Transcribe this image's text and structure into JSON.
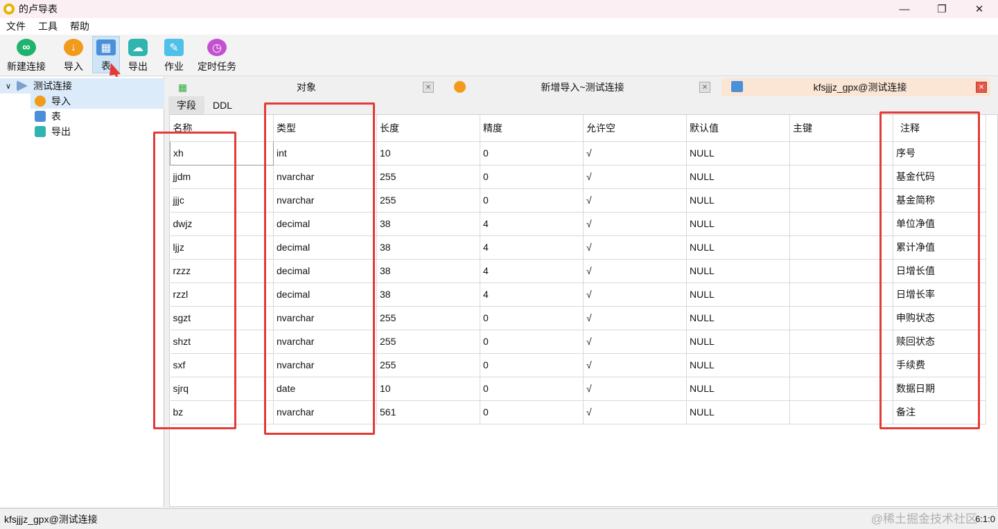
{
  "window": {
    "title": "的卢导表"
  },
  "menu": [
    "文件",
    "工具",
    "帮助"
  ],
  "toolbar": {
    "new_connection": "新建连接",
    "import": "导入",
    "table": "表",
    "export": "导出",
    "job": "作业",
    "scheduled_task": "定时任务"
  },
  "tree": {
    "root": "测试连接",
    "children": [
      "导入",
      "表",
      "导出"
    ]
  },
  "tabs": {
    "objects": "对象",
    "new_import": "新增导入~测试连接",
    "table": "kfsjjjz_gpx@测试连接"
  },
  "subtabs": {
    "fields": "字段",
    "ddl": "DDL"
  },
  "grid": {
    "headers": [
      "名称",
      "类型",
      "长度",
      "精度",
      "允许空",
      "默认值",
      "主键",
      "注释"
    ],
    "rows": [
      [
        "xh",
        "int",
        "10",
        "0",
        "√",
        "NULL",
        "",
        "序号"
      ],
      [
        "jjdm",
        "nvarchar",
        "255",
        "0",
        "√",
        "NULL",
        "",
        "基金代码"
      ],
      [
        "jjjc",
        "nvarchar",
        "255",
        "0",
        "√",
        "NULL",
        "",
        "基金简称"
      ],
      [
        "dwjz",
        "decimal",
        "38",
        "4",
        "√",
        "NULL",
        "",
        "单位净值"
      ],
      [
        "ljjz",
        "decimal",
        "38",
        "4",
        "√",
        "NULL",
        "",
        "累计净值"
      ],
      [
        "rzzz",
        "decimal",
        "38",
        "4",
        "√",
        "NULL",
        "",
        "日增长值"
      ],
      [
        "rzzl",
        "decimal",
        "38",
        "4",
        "√",
        "NULL",
        "",
        "日增长率"
      ],
      [
        "sgzt",
        "nvarchar",
        "255",
        "0",
        "√",
        "NULL",
        "",
        "申购状态"
      ],
      [
        "shzt",
        "nvarchar",
        "255",
        "0",
        "√",
        "NULL",
        "",
        "赎回状态"
      ],
      [
        "sxf",
        "nvarchar",
        "255",
        "0",
        "√",
        "NULL",
        "",
        "手续费"
      ],
      [
        "sjrq",
        "date",
        "10",
        "0",
        "√",
        "NULL",
        "",
        "数据日期"
      ],
      [
        "bz",
        "nvarchar",
        "561",
        "0",
        "√",
        "NULL",
        "",
        "备注"
      ]
    ]
  },
  "status": {
    "left": "kfsjjjz_gpx@测试连接",
    "right": "6:1:0",
    "watermark": "@稀土掘金技术社区"
  },
  "icons": {
    "app": "app-icon",
    "new_connection": "link-icon",
    "import": "import-icon",
    "table": "table-icon",
    "export": "cloud-export-icon",
    "job": "job-icon",
    "scheduled_task": "clock-icon"
  },
  "colors": {
    "annotation": "#e53935",
    "selection": "#dcebfa",
    "titlebar": "#fbeff3"
  }
}
